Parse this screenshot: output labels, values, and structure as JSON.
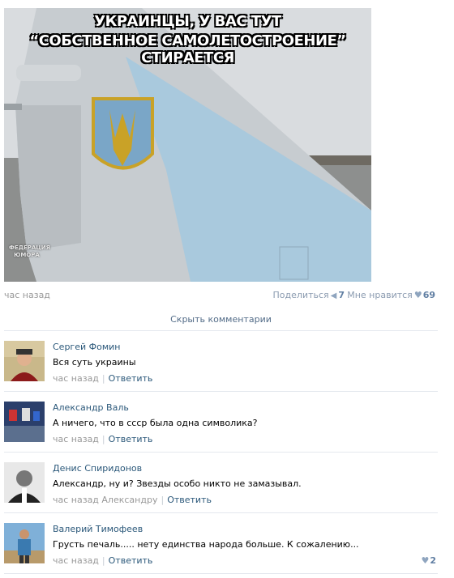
{
  "image": {
    "caption_line1": "УКРАИНЦЫ, У ВАС ТУТ",
    "caption_line2": "“СОБСТВЕННОЕ САМОЛЕТОСТРОЕНИЕ” СТИРАЕТСЯ",
    "watermark": "ФЕДЕРАЦИЯ ЮМОРА"
  },
  "post": {
    "time": "час назад",
    "share_label": "Поделиться",
    "share_count": "7",
    "like_label": "Мне нравится",
    "like_count": "69"
  },
  "hide_comments": "Скрыть комментарии",
  "comments": [
    {
      "author": "Сергей Фомин",
      "text": "Вся суть украины",
      "time": "час назад",
      "reply": "Ответить",
      "likes": ""
    },
    {
      "author": "Александр Валь",
      "text": "А ничего, что в ссср была одна символика?",
      "time": "час назад",
      "reply": "Ответить",
      "likes": ""
    },
    {
      "author": "Денис Спиридонов",
      "text": "Александр, ну и? Звезды особо никто не замазывал.",
      "time": "час назад Александру",
      "reply": "Ответить",
      "likes": ""
    },
    {
      "author": "Валерий Тимофеев",
      "text": "Грусть печаль..... нету единства народа больше. К сожалению...",
      "time": "час назад",
      "reply": "Ответить",
      "likes": "2"
    }
  ],
  "colors": {
    "link": "#2b587a",
    "meta": "#999999",
    "divider": "#e4e8ee",
    "accent": "#617fa3"
  }
}
